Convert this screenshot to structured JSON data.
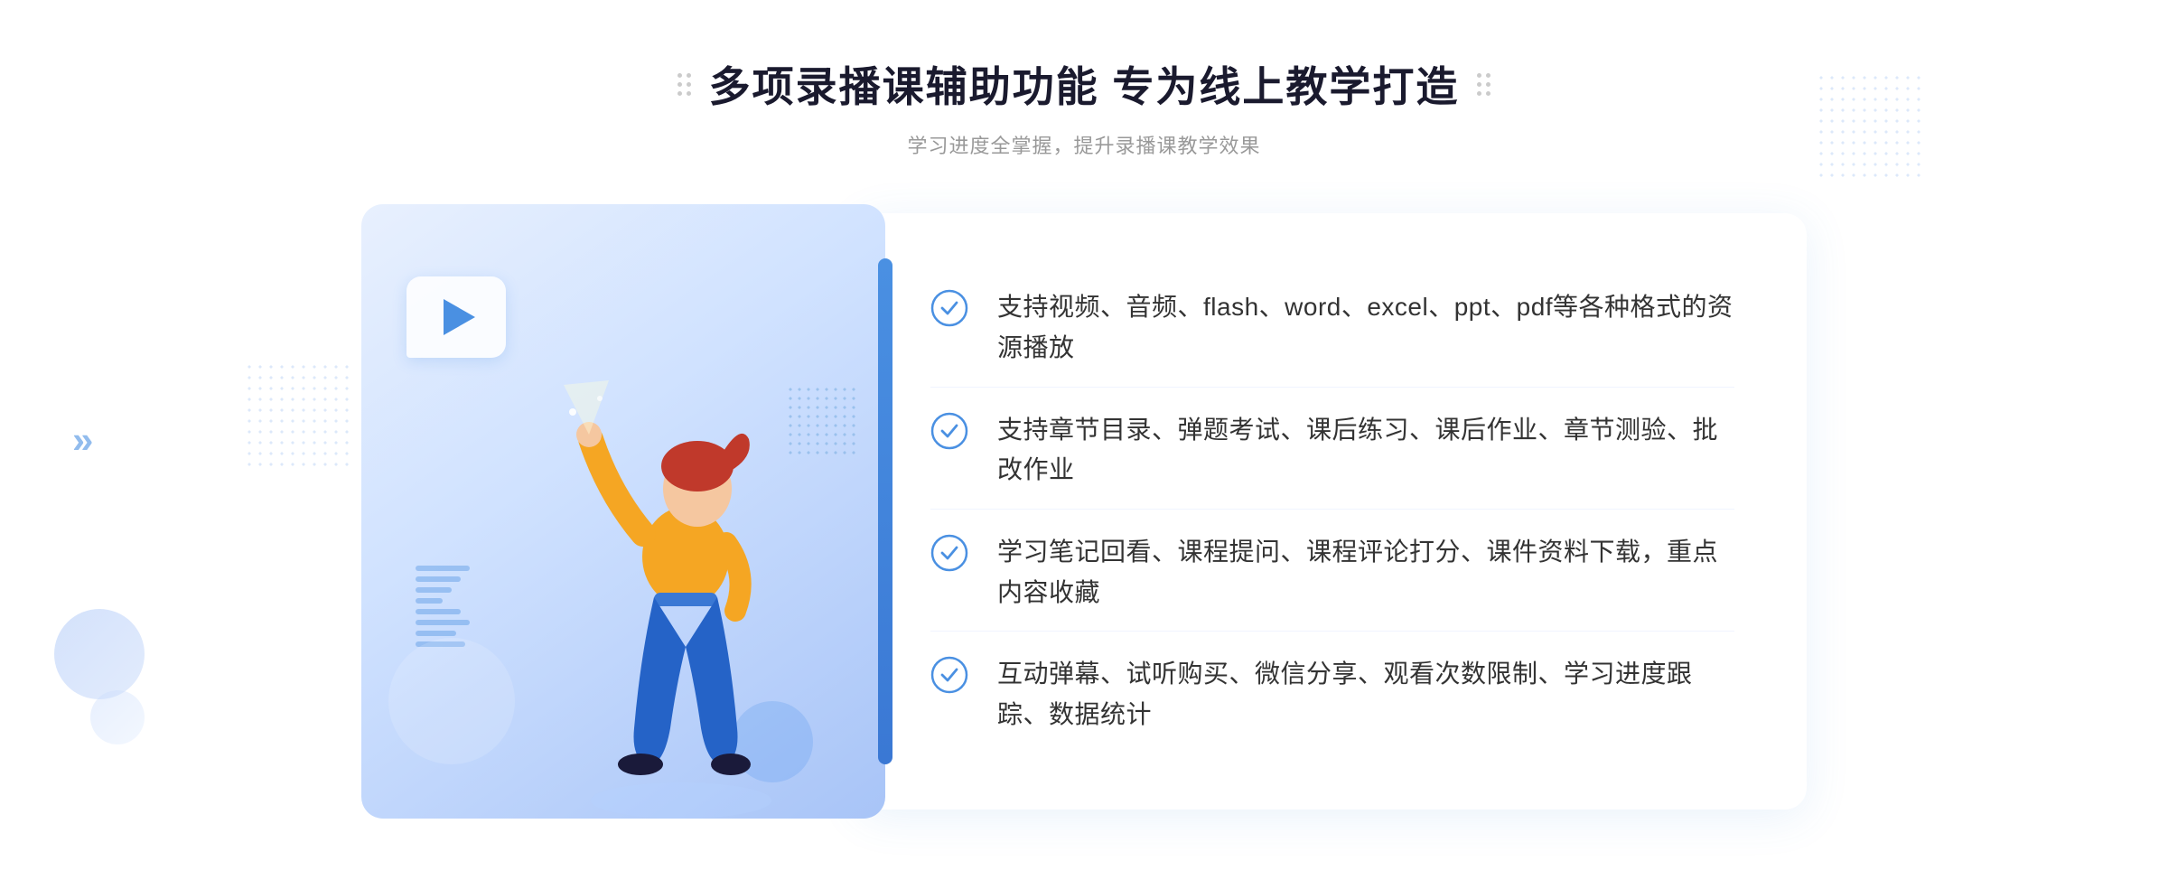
{
  "header": {
    "title": "多项录播课辅助功能 专为线上教学打造",
    "subtitle": "学习进度全掌握，提升录播课教学效果"
  },
  "features": [
    {
      "id": "feature-1",
      "text": "支持视频、音频、flash、word、excel、ppt、pdf等各种格式的资源播放"
    },
    {
      "id": "feature-2",
      "text": "支持章节目录、弹题考试、课后练习、课后作业、章节测验、批改作业"
    },
    {
      "id": "feature-3",
      "text": "学习笔记回看、课程提问、课程评论打分、课件资料下载，重点内容收藏"
    },
    {
      "id": "feature-4",
      "text": "互动弹幕、试听购买、微信分享、观看次数限制、学习进度跟踪、数据统计"
    }
  ],
  "icons": {
    "check": "check-circle-icon",
    "play": "play-icon",
    "chevron": "chevron-icon"
  },
  "colors": {
    "accent": "#4a90e2",
    "title": "#1a1a2e",
    "subtitle": "#999999",
    "text": "#333333",
    "check": "#4a90e2",
    "bg": "#ffffff"
  }
}
